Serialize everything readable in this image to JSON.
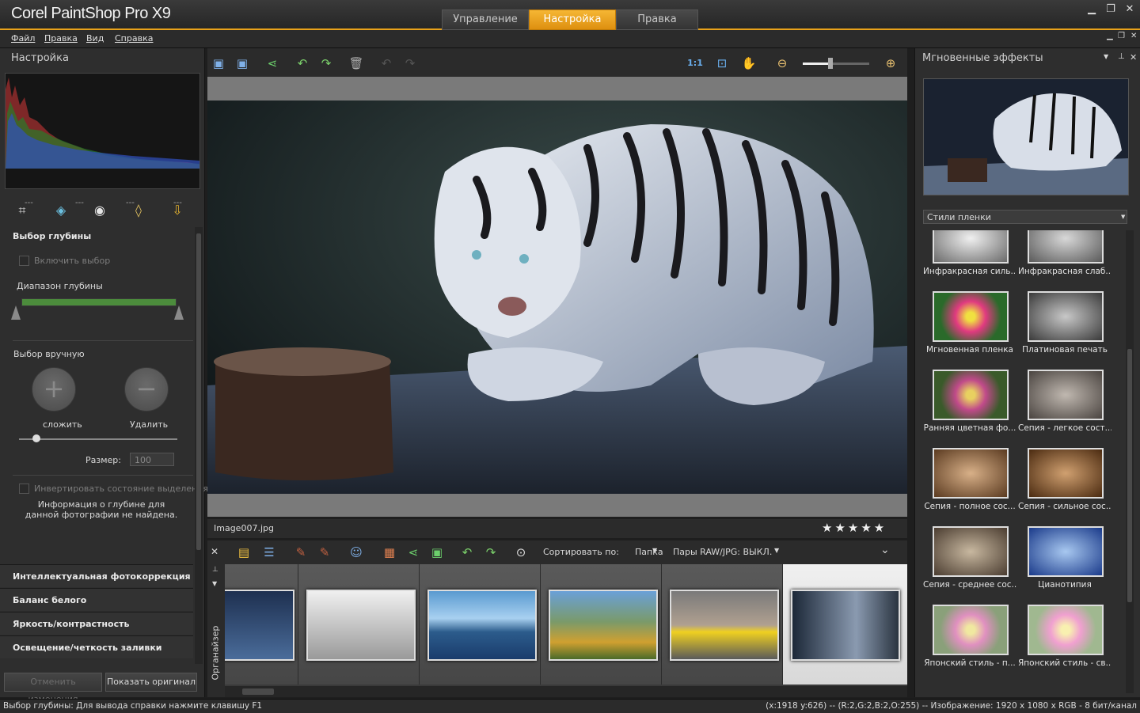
{
  "app": {
    "title": "Corel PaintShop Pro X9"
  },
  "mode_tabs": [
    {
      "label": "Управление"
    },
    {
      "label": "Настройка",
      "active": true
    },
    {
      "label": "Правка"
    }
  ],
  "menu": [
    "Файл",
    "Правка",
    "Вид",
    "Справка"
  ],
  "left_panel": {
    "title": "Настройка",
    "histogram_labels": [
      "---",
      "---",
      "---",
      "---"
    ],
    "tools": [
      "crop-icon",
      "straighten-icon",
      "red-eye-icon",
      "retouch-icon",
      "smart-photo-fix-icon"
    ],
    "depth_section": {
      "title": "Выбор глубины",
      "enable_checkbox": "Включить выбор",
      "range_label": "Диапазон глубины",
      "manual_label": "Выбор вручную",
      "add_label": "сложить",
      "remove_label": "Удалить",
      "size_label": "Размер:",
      "size_value": "100",
      "invert_checkbox": "Инвертировать состояние выделения",
      "info_text": "Информация о глубине для данной фотографии не найдена."
    },
    "accordions": [
      "Интеллектуальная фотокоррекция",
      "Баланс белого",
      "Яркость/контрастность",
      "Освещение/четкость заливки"
    ],
    "buttons": {
      "undo": "Отменить изменения",
      "show_original": "Показать оригинал"
    }
  },
  "canvas": {
    "filename": "Image007.jpg",
    "rating_stars": "★★★★★"
  },
  "organizer": {
    "sort_label": "Сортировать по:",
    "sort_value": "Папка",
    "raw_pairs": "Пары RAW/JPG: ВЫКЛ.",
    "side_label": "Органайзер"
  },
  "right_panel": {
    "title": "Мгновенные эффекты",
    "category": "Стили пленки",
    "effects": [
      "Инфракрасная силь...",
      "Инфракрасная слаб...",
      "Мгновенная пленка",
      "Платиновая печать",
      "Ранняя цветная фо...",
      "Сепия - легкое сост...",
      "Сепия - полное сос...",
      "Сепия - сильное сос...",
      "Сепия - среднее сос...",
      "Цианотипия",
      "Японский стиль - п...",
      "Японский стиль - св..."
    ]
  },
  "status": {
    "left": "Выбор глубины: Для вывода справки нажмите клавишу F1",
    "right": "(x:1918 y:626) -- (R:2,G:2,B:2,O:255) -- Изображение:  1920 x 1080 x RGB - 8 бит/канал"
  }
}
